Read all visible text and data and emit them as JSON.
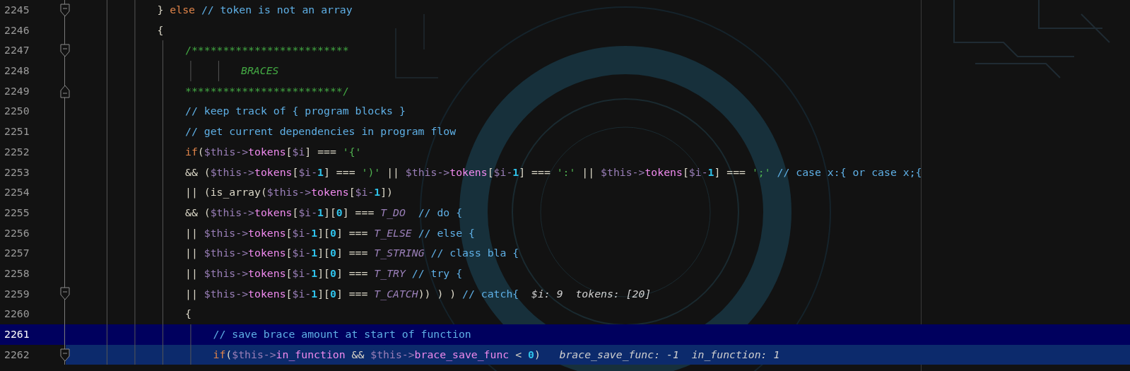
{
  "editor": {
    "lines": [
      {
        "number": "2245",
        "fold_start": true,
        "fold_end": false,
        "current": false,
        "selected": false,
        "tokens": [
          {
            "kind": "plain",
            "text": "\t\t\t} "
          },
          {
            "kind": "keyword",
            "text": "else"
          },
          {
            "kind": "comment",
            "text": " // token is not an array"
          }
        ]
      },
      {
        "number": "2246",
        "fold_start": false,
        "fold_end": false,
        "current": false,
        "selected": false,
        "tokens": [
          {
            "kind": "plain",
            "text": "\t\t\t{"
          }
        ]
      },
      {
        "number": "2247",
        "fold_start": true,
        "fold_end": false,
        "current": false,
        "selected": false,
        "tokens": [
          {
            "kind": "block-comment",
            "text": "\t\t\t\t/*************************"
          }
        ]
      },
      {
        "number": "2248",
        "fold_start": false,
        "fold_end": false,
        "current": false,
        "selected": false,
        "tokens": [
          {
            "kind": "block-comment-tag",
            "text": "\t\t\t\t\t\tBRACES"
          }
        ]
      },
      {
        "number": "2249",
        "fold_start": false,
        "fold_end": true,
        "current": false,
        "selected": false,
        "tokens": [
          {
            "kind": "block-comment",
            "text": "\t\t\t\t*************************/"
          }
        ]
      },
      {
        "number": "2250",
        "fold_start": false,
        "fold_end": false,
        "current": false,
        "selected": false,
        "tokens": [
          {
            "kind": "comment",
            "text": "\t\t\t\t// keep track of { program blocks }"
          }
        ]
      },
      {
        "number": "2251",
        "fold_start": false,
        "fold_end": false,
        "current": false,
        "selected": false,
        "tokens": [
          {
            "kind": "comment",
            "text": "\t\t\t\t// get current dependencies in program flow"
          }
        ]
      },
      {
        "number": "2252",
        "fold_start": false,
        "fold_end": false,
        "current": false,
        "selected": false,
        "tokens": [
          {
            "kind": "keyword",
            "text": "\t\t\t\tif"
          },
          {
            "kind": "plain",
            "text": "("
          },
          {
            "kind": "variable",
            "text": "$this->"
          },
          {
            "kind": "property",
            "text": "tokens"
          },
          {
            "kind": "plain",
            "text": "["
          },
          {
            "kind": "variable",
            "text": "$i"
          },
          {
            "kind": "plain",
            "text": "] === "
          },
          {
            "kind": "string",
            "text": "'{'"
          }
        ]
      },
      {
        "number": "2253",
        "fold_start": false,
        "fold_end": false,
        "current": false,
        "selected": false,
        "tokens": [
          {
            "kind": "plain",
            "text": "\t\t\t\t&& ("
          },
          {
            "kind": "variable",
            "text": "$this->"
          },
          {
            "kind": "property",
            "text": "tokens"
          },
          {
            "kind": "plain",
            "text": "["
          },
          {
            "kind": "variable",
            "text": "$i-"
          },
          {
            "kind": "number",
            "text": "1"
          },
          {
            "kind": "plain",
            "text": "] === "
          },
          {
            "kind": "string",
            "text": "')'"
          },
          {
            "kind": "plain",
            "text": " || "
          },
          {
            "kind": "variable",
            "text": "$this->"
          },
          {
            "kind": "property",
            "text": "tokens"
          },
          {
            "kind": "plain",
            "text": "["
          },
          {
            "kind": "variable",
            "text": "$i-"
          },
          {
            "kind": "number",
            "text": "1"
          },
          {
            "kind": "plain",
            "text": "] === "
          },
          {
            "kind": "string",
            "text": "':'"
          },
          {
            "kind": "plain",
            "text": " || "
          },
          {
            "kind": "variable",
            "text": "$this->"
          },
          {
            "kind": "property",
            "text": "tokens"
          },
          {
            "kind": "plain",
            "text": "["
          },
          {
            "kind": "variable",
            "text": "$i-"
          },
          {
            "kind": "number",
            "text": "1"
          },
          {
            "kind": "plain",
            "text": "] === "
          },
          {
            "kind": "string",
            "text": "';'"
          },
          {
            "kind": "comment",
            "text": " // case x:{ or case x;{"
          }
        ]
      },
      {
        "number": "2254",
        "fold_start": false,
        "fold_end": false,
        "current": false,
        "selected": false,
        "tokens": [
          {
            "kind": "plain",
            "text": "\t\t\t\t|| (is_array("
          },
          {
            "kind": "variable",
            "text": "$this->"
          },
          {
            "kind": "property",
            "text": "tokens"
          },
          {
            "kind": "plain",
            "text": "["
          },
          {
            "kind": "variable",
            "text": "$i-"
          },
          {
            "kind": "number",
            "text": "1"
          },
          {
            "kind": "plain",
            "text": "])"
          }
        ]
      },
      {
        "number": "2255",
        "fold_start": false,
        "fold_end": false,
        "current": false,
        "selected": false,
        "tokens": [
          {
            "kind": "plain",
            "text": "\t\t\t\t&& ("
          },
          {
            "kind": "variable",
            "text": "$this->"
          },
          {
            "kind": "property",
            "text": "tokens"
          },
          {
            "kind": "plain",
            "text": "["
          },
          {
            "kind": "variable",
            "text": "$i-"
          },
          {
            "kind": "number",
            "text": "1"
          },
          {
            "kind": "plain",
            "text": "]["
          },
          {
            "kind": "number",
            "text": "0"
          },
          {
            "kind": "plain",
            "text": "] === "
          },
          {
            "kind": "constant",
            "text": "T_DO"
          },
          {
            "kind": "comment",
            "text": "  // do {"
          }
        ]
      },
      {
        "number": "2256",
        "fold_start": false,
        "fold_end": false,
        "current": false,
        "selected": false,
        "tokens": [
          {
            "kind": "plain",
            "text": "\t\t\t\t|| "
          },
          {
            "kind": "variable",
            "text": "$this->"
          },
          {
            "kind": "property",
            "text": "tokens"
          },
          {
            "kind": "plain",
            "text": "["
          },
          {
            "kind": "variable",
            "text": "$i-"
          },
          {
            "kind": "number",
            "text": "1"
          },
          {
            "kind": "plain",
            "text": "]["
          },
          {
            "kind": "number",
            "text": "0"
          },
          {
            "kind": "plain",
            "text": "] === "
          },
          {
            "kind": "constant",
            "text": "T_ELSE"
          },
          {
            "kind": "comment",
            "text": " // else {"
          }
        ]
      },
      {
        "number": "2257",
        "fold_start": false,
        "fold_end": false,
        "current": false,
        "selected": false,
        "tokens": [
          {
            "kind": "plain",
            "text": "\t\t\t\t|| "
          },
          {
            "kind": "variable",
            "text": "$this->"
          },
          {
            "kind": "property",
            "text": "tokens"
          },
          {
            "kind": "plain",
            "text": "["
          },
          {
            "kind": "variable",
            "text": "$i-"
          },
          {
            "kind": "number",
            "text": "1"
          },
          {
            "kind": "plain",
            "text": "]["
          },
          {
            "kind": "number",
            "text": "0"
          },
          {
            "kind": "plain",
            "text": "] === "
          },
          {
            "kind": "constant",
            "text": "T_STRING"
          },
          {
            "kind": "comment",
            "text": " // class bla {"
          }
        ]
      },
      {
        "number": "2258",
        "fold_start": false,
        "fold_end": false,
        "current": false,
        "selected": false,
        "tokens": [
          {
            "kind": "plain",
            "text": "\t\t\t\t|| "
          },
          {
            "kind": "variable",
            "text": "$this->"
          },
          {
            "kind": "property",
            "text": "tokens"
          },
          {
            "kind": "plain",
            "text": "["
          },
          {
            "kind": "variable",
            "text": "$i-"
          },
          {
            "kind": "number",
            "text": "1"
          },
          {
            "kind": "plain",
            "text": "]["
          },
          {
            "kind": "number",
            "text": "0"
          },
          {
            "kind": "plain",
            "text": "] === "
          },
          {
            "kind": "constant",
            "text": "T_TRY"
          },
          {
            "kind": "comment",
            "text": " // try {"
          }
        ]
      },
      {
        "number": "2259",
        "fold_start": true,
        "fold_end": false,
        "current": false,
        "selected": false,
        "tokens": [
          {
            "kind": "plain",
            "text": "\t\t\t\t|| "
          },
          {
            "kind": "variable",
            "text": "$this->"
          },
          {
            "kind": "property",
            "text": "tokens"
          },
          {
            "kind": "plain",
            "text": "["
          },
          {
            "kind": "variable",
            "text": "$i-"
          },
          {
            "kind": "number",
            "text": "1"
          },
          {
            "kind": "plain",
            "text": "]["
          },
          {
            "kind": "number",
            "text": "0"
          },
          {
            "kind": "plain",
            "text": "] === "
          },
          {
            "kind": "constant",
            "text": "T_CATCH"
          },
          {
            "kind": "plain",
            "text": ")) ) )"
          },
          {
            "kind": "comment",
            "text": " // catch{"
          },
          {
            "kind": "inline-value",
            "text": "  $i: 9  tokens: [20]"
          }
        ]
      },
      {
        "number": "2260",
        "fold_start": false,
        "fold_end": false,
        "current": false,
        "selected": false,
        "tokens": [
          {
            "kind": "plain",
            "text": "\t\t\t\t{"
          }
        ]
      },
      {
        "number": "2261",
        "fold_start": false,
        "fold_end": false,
        "current": true,
        "selected": false,
        "tokens": [
          {
            "kind": "comment",
            "text": "\t\t\t\t\t// save brace amount at start of function"
          }
        ]
      },
      {
        "number": "2262",
        "fold_start": true,
        "fold_end": false,
        "current": false,
        "selected": true,
        "tokens": [
          {
            "kind": "keyword",
            "text": "\t\t\t\t\tif"
          },
          {
            "kind": "plain",
            "text": "("
          },
          {
            "kind": "variable",
            "text": "$this->"
          },
          {
            "kind": "property",
            "text": "in_function"
          },
          {
            "kind": "plain",
            "text": " && "
          },
          {
            "kind": "variable",
            "text": "$this->"
          },
          {
            "kind": "property",
            "text": "brace_save_func"
          },
          {
            "kind": "plain",
            "text": " < "
          },
          {
            "kind": "number",
            "text": "0"
          },
          {
            "kind": "plain",
            "text": ")"
          },
          {
            "kind": "inline-value",
            "text": "   brace_save_func: -1  in_function: 1"
          }
        ]
      }
    ]
  }
}
